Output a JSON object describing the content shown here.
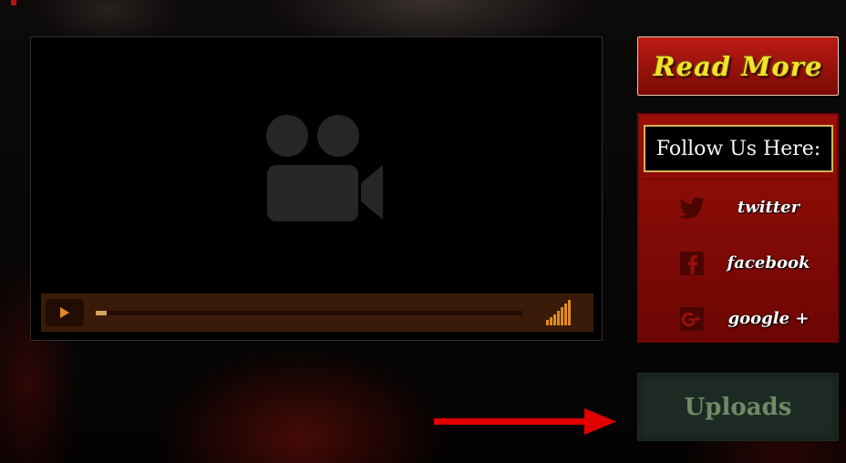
{
  "player": {
    "progress_fraction": 0.025,
    "icons": {
      "placeholder": "video-camera-icon",
      "play": "play-icon",
      "volume": "volume-bars-icon"
    }
  },
  "sidebar": {
    "read_more_label": "Read More",
    "follow": {
      "title": "Follow Us Here:",
      "items": [
        {
          "label": "twitter",
          "icon": "twitter-icon"
        },
        {
          "label": "facebook",
          "icon": "facebook-icon"
        },
        {
          "label": "google +",
          "icon": "google-plus-icon"
        }
      ]
    },
    "uploads_label": "Uploads"
  },
  "annotation": {
    "arrow": "red-arrow-icon",
    "arrow_color": "#e00000"
  },
  "colors": {
    "accent_red": "#9a0f08",
    "gold_text": "#f2e32a",
    "uploads_bg": "#1d2a24",
    "uploads_text": "#6f8a66",
    "player_bar": "#3a1a08",
    "progress": "#d7a162",
    "volume": "#e08a1f"
  }
}
